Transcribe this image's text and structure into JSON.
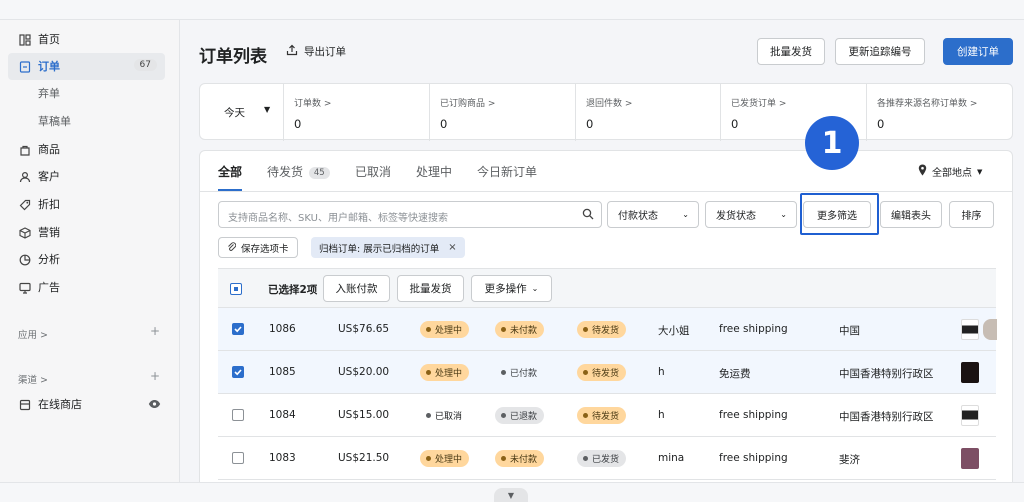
{
  "sidebar": {
    "items": [
      {
        "label": "首页",
        "icon": "home-icon"
      },
      {
        "label": "订单",
        "icon": "orders-icon",
        "badge": "67",
        "active": true
      },
      {
        "label": "弃单",
        "sub": true
      },
      {
        "label": "草稿单",
        "sub": true
      },
      {
        "label": "商品",
        "icon": "products-icon"
      },
      {
        "label": "客户",
        "icon": "customers-icon"
      },
      {
        "label": "折扣",
        "icon": "discount-icon"
      },
      {
        "label": "营销",
        "icon": "marketing-icon"
      },
      {
        "label": "分析",
        "icon": "analytics-icon"
      },
      {
        "label": "广告",
        "icon": "ads-icon"
      }
    ],
    "apps_label": "应用 >",
    "channels_label": "渠道 >",
    "online_store": "在线商店"
  },
  "header": {
    "title": "订单列表",
    "export": "导出订单",
    "bulk_ship": "批量发货",
    "update_tracking": "更新追踪编号",
    "create_order": "创建订单"
  },
  "stats": {
    "period": "今天",
    "items": [
      {
        "label": "订单数 >",
        "value": "0"
      },
      {
        "label": "已订购商品 >",
        "value": "0"
      },
      {
        "label": "退回件数 >",
        "value": "0"
      },
      {
        "label": "已发货订单 >",
        "value": "0"
      },
      {
        "label": "各推荐来源名称订单数 >",
        "value": "0"
      }
    ]
  },
  "tabs": [
    {
      "label": "全部",
      "active": true
    },
    {
      "label": "待发货",
      "count": "45"
    },
    {
      "label": "已取消"
    },
    {
      "label": "处理中"
    },
    {
      "label": "今日新订单"
    }
  ],
  "location": "全部地点",
  "filters": {
    "search_placeholder": "支持商品名称、SKU、用户邮箱、标签等快速搜索",
    "payment_status": "付款状态",
    "shipping_status": "发货状态",
    "more_filters": "更多筛选",
    "edit_columns": "编辑表头",
    "sort": "排序",
    "save_tab": "保存选项卡",
    "archived_chip": "归档订单: 展示已归档的订单"
  },
  "bulk": {
    "selected": "已选择2项",
    "mark_paid": "入账付款",
    "bulk_ship": "批量发货",
    "more_actions": "更多操作"
  },
  "orders": [
    {
      "id": "1086",
      "amount": "US$76.65",
      "status": "处理中",
      "payment": "未付款",
      "fulfillment": "待发货",
      "customer": "大小姐",
      "shipping": "free shipping",
      "region": "中国",
      "checked": true
    },
    {
      "id": "1085",
      "amount": "US$20.00",
      "status": "处理中",
      "payment": "已付款",
      "fulfillment": "待发货",
      "customer": "h",
      "shipping": "免运费",
      "region": "中国香港特别行政区",
      "checked": true
    },
    {
      "id": "1084",
      "amount": "US$15.00",
      "status": "已取消",
      "payment": "已退款",
      "fulfillment": "待发货",
      "customer": "h",
      "shipping": "free shipping",
      "region": "中国香港特别行政区",
      "checked": false
    },
    {
      "id": "1083",
      "amount": "US$21.50",
      "status": "处理中",
      "payment": "未付款",
      "fulfillment": "已发货",
      "customer": "mina",
      "shipping": "free shipping",
      "region": "斐济",
      "checked": false
    }
  ],
  "callout": "1",
  "colors": {
    "accent": "#2c6ecb",
    "callout": "#2563d6",
    "warning_pill": "#ffd79d"
  }
}
